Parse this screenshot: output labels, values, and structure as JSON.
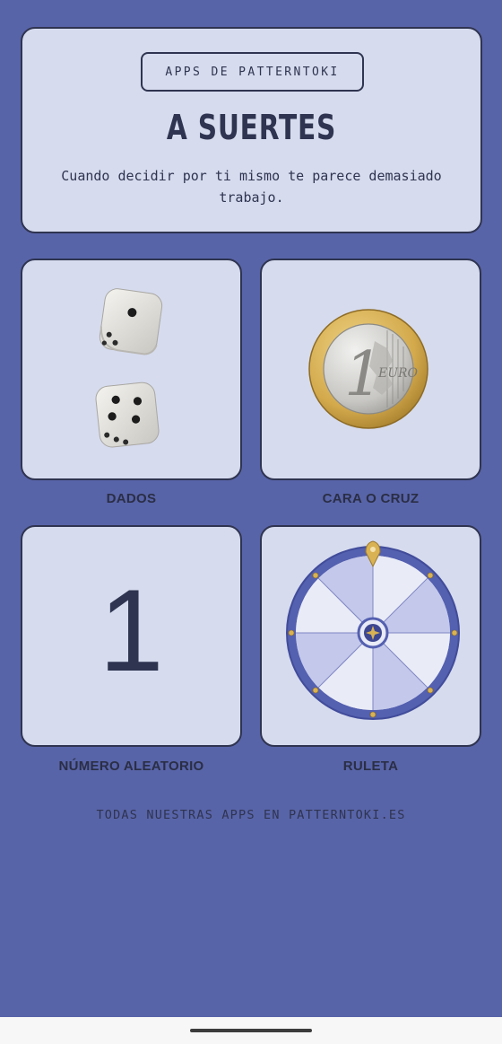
{
  "header": {
    "badge": "APPS DE PATTERNTOKI",
    "title": "A SUERTES",
    "tagline": "Cuando decidir por ti mismo te parece demasiado trabajo."
  },
  "tiles": [
    {
      "label": "DADOS",
      "icon": "dice-icon"
    },
    {
      "label": "CARA O CRUZ",
      "icon": "euro-coin-icon"
    },
    {
      "label": "NÚMERO ALEATORIO",
      "value": "1"
    },
    {
      "label": "RULETA",
      "icon": "roulette-wheel-icon"
    }
  ],
  "coin": {
    "value": "1",
    "currency": "EURO"
  },
  "footer": {
    "link": "TODAS NUESTRAS APPS EN PATTERNTOKI.ES"
  },
  "colors": {
    "background": "#5864a8",
    "card": "#d6dbee",
    "border": "#2f3450",
    "wheel_ring": "#5460b0",
    "gold": "#d9b253"
  }
}
